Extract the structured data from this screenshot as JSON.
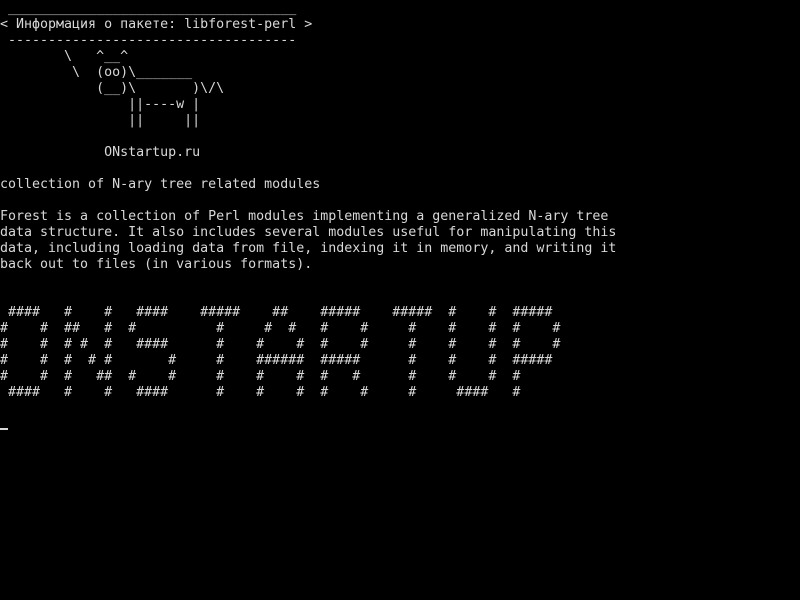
{
  "cowsay": {
    "border_top": " ____________________________________",
    "message": "< Информация о пакете: libforest-perl >",
    "border_bottom": " ------------------------------------",
    "cow": "        \\   ^__^\n         \\  (oo)\\_______\n            (__)\\       )\\/\\\n                ||----w |\n                ||     ||"
  },
  "site": "             ONstartup.ru",
  "package": {
    "summary": "collection of N-ary tree related modules",
    "description": "Forest is a collection of Perl modules implementing a generalized N-ary tree\ndata structure. It also includes several modules useful for manipulating this\ndata, including loading data from file, indexing it in memory, and writing it\nback out to files (in various formats)."
  },
  "banner": " ####   #    #   ####    #####    ##    #####    #####  #    #  #####\n#    #  ##   #  #          #     #  #   #    #     #    #    #  #    #\n#    #  # #  #   ####      #    #    #  #    #     #    #    #  #    #\n#    #  #  # #       #     #    ######  #####      #    #    #  #####\n#    #  #   ##  #    #     #    #    #  #   #      #    #    #  #\n ####   #    #   ####      #    #    #  #    #     #     ####   #",
  "colors": {
    "background": "#000000",
    "foreground": "#d8d8d8"
  }
}
